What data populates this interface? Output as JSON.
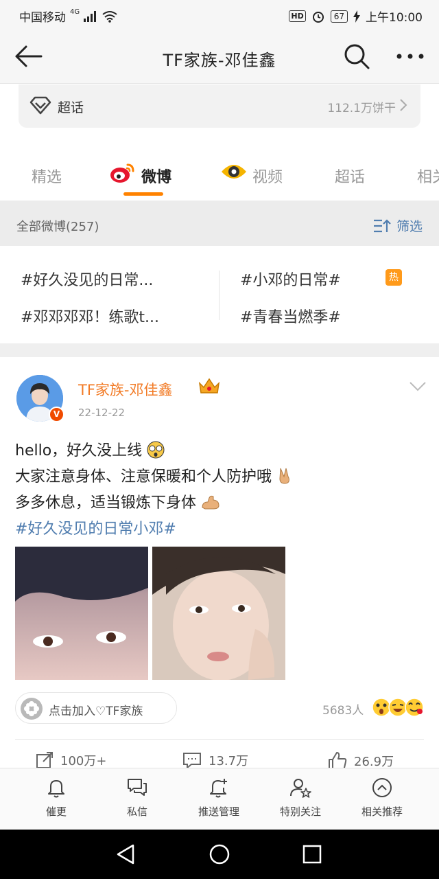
{
  "status_bar": {
    "carrier": "中国移动",
    "network": "4G",
    "hd": "HD",
    "battery": "67",
    "time": "上午10:00"
  },
  "navbar": {
    "title": "TF家族-邓佳鑫"
  },
  "supertopic": {
    "label": "超话",
    "count": "112.1万饼干"
  },
  "tabs": [
    {
      "label": "精选"
    },
    {
      "label": "微博"
    },
    {
      "label": "视频"
    },
    {
      "label": "超话"
    },
    {
      "label": "相关"
    }
  ],
  "section": {
    "title": "全部微博(257)",
    "filter_label": "筛选"
  },
  "topics": [
    "#好久没见的日常...",
    "#小邓的日常#",
    "#邓邓邓邓！练歌t...",
    "#青春当燃季#"
  ],
  "hot_badge": "热",
  "post": {
    "author": "TF家族-邓佳鑫",
    "verified_badge": "V",
    "date": "22-12-22",
    "lines": [
      "hello，好久没上线",
      "大家注意身体、注意保暖和个人防护哦",
      "多多休息，适当锻炼下身体"
    ],
    "hashtag": "#好久没见的日常小邓#",
    "join_label": "点击加入♡TF家族",
    "reads": "5683人",
    "reposts": "100万+",
    "comments": "13.7万",
    "likes": "26.9万"
  },
  "bottom_tabs": [
    {
      "label": "催更"
    },
    {
      "label": "私信"
    },
    {
      "label": "推送管理"
    },
    {
      "label": "特别关注"
    },
    {
      "label": "相关推荐"
    }
  ],
  "colors": {
    "accent_orange": "#ff8200",
    "link_blue": "#507daf",
    "author_orange": "#f27b26"
  }
}
